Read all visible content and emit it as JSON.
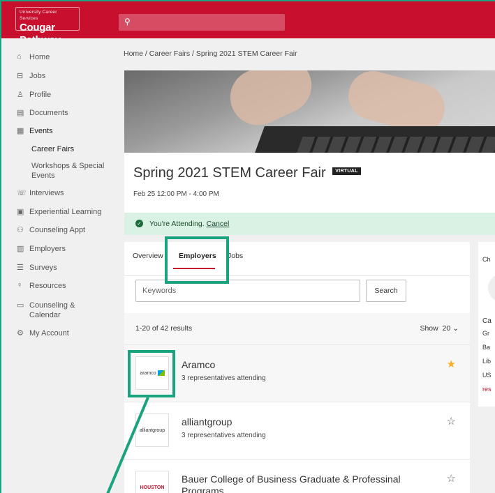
{
  "header": {
    "logo_small": "University Career Services",
    "logo_big": "Cougar Pathway",
    "search_icon": "search-icon"
  },
  "sidebar": {
    "items": [
      {
        "icon": "⌂",
        "label": "Home"
      },
      {
        "icon": "⊟",
        "label": "Jobs"
      },
      {
        "icon": "♙",
        "label": "Profile"
      },
      {
        "icon": "▤",
        "label": "Documents"
      },
      {
        "icon": "▦",
        "label": "Events"
      },
      {
        "icon": "☏",
        "label": "Interviews"
      },
      {
        "icon": "▣",
        "label": "Experiential Learning"
      },
      {
        "icon": "⚇",
        "label": "Counseling Appt"
      },
      {
        "icon": "▥",
        "label": "Employers"
      },
      {
        "icon": "☰",
        "label": "Surveys"
      },
      {
        "icon": "♀",
        "label": "Resources"
      },
      {
        "icon": "▭",
        "label": "Counseling & Calendar"
      },
      {
        "icon": "⚙",
        "label": "My Account"
      }
    ],
    "sub_events": [
      "Career Fairs",
      "Workshops & Special Events"
    ]
  },
  "breadcrumb": {
    "home": "Home",
    "sep": " / ",
    "fairs": "Career Fairs",
    "current": "Spring 2021 STEM Career Fair"
  },
  "event": {
    "title": "Spring 2021 STEM Career Fair",
    "badge": "VIRTUAL",
    "date": "Feb 25 12:00 PM - 4:00 PM",
    "attending_text": "You're Attending.",
    "cancel_label": "Cancel"
  },
  "tabs": [
    "Overview",
    "Employers",
    "Jobs"
  ],
  "search": {
    "placeholder": "Keywords",
    "button": "Search"
  },
  "results": {
    "count": "1-20 of 42 results",
    "show_label": "Show",
    "show_value": "20"
  },
  "employers": [
    {
      "name": "Aramco",
      "sub": "3 representatives attending",
      "logo": "aramco",
      "starred": true
    },
    {
      "name": "alliantgroup",
      "sub": "3 representatives attending",
      "logo": "alliantgroup",
      "starred": false
    },
    {
      "name": "Bauer College of Business Graduate & Professinal Programs",
      "sub": "",
      "logo": "HOUSTON",
      "starred": false
    }
  ],
  "right_card": {
    "lines": [
      "Ch",
      "Ca",
      "Gr",
      "Ba",
      "Lib",
      "US",
      "res"
    ]
  },
  "colors": {
    "brand": "#c8102e",
    "annotation": "#1aa37f",
    "star": "#f5b022"
  }
}
